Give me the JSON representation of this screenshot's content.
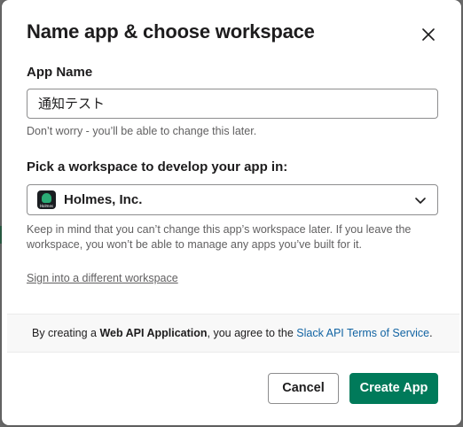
{
  "dialog": {
    "title": "Name app & choose workspace",
    "close_icon": "close-icon"
  },
  "app_name": {
    "label": "App Name",
    "value": "通知テスト",
    "hint": "Don’t worry - you’ll be able to change this later."
  },
  "workspace": {
    "label": "Pick a workspace to develop your app in:",
    "selected": "Holmes, Inc.",
    "avatar_text": "Holmes",
    "hint": "Keep in mind that you can’t change this app’s workspace later. If you leave the workspace, you won’t be able to manage any apps you’ve built for it.",
    "chevron_icon": "chevron-down-icon"
  },
  "sign_in_link": "Sign into a different workspace",
  "terms": {
    "prefix": "By creating a ",
    "bold": "Web API Application",
    "middle": ", you agree to the ",
    "link": "Slack API Terms of Service",
    "suffix": "."
  },
  "actions": {
    "cancel_label": "Cancel",
    "create_label": "Create App"
  },
  "colors": {
    "primary": "#007a5a",
    "link": "#1264a3",
    "text": "#1d1c1d",
    "muted": "#616061"
  }
}
